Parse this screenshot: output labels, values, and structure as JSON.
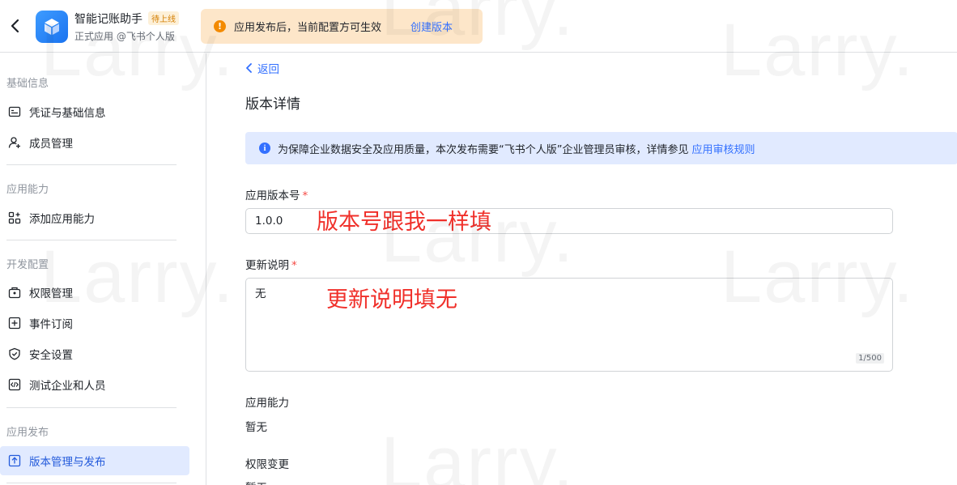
{
  "header": {
    "app_name": "智能记账助手",
    "app_badge": "待上线",
    "app_type": "正式应用 @飞书个人版",
    "notice_text": "应用发布后，当前配置方可生效",
    "notice_link": "创建版本"
  },
  "sidebar": {
    "sections": [
      {
        "title": "基础信息",
        "items": [
          "凭证与基础信息",
          "成员管理"
        ]
      },
      {
        "title": "应用能力",
        "items": [
          "添加应用能力"
        ]
      },
      {
        "title": "开发配置",
        "items": [
          "权限管理",
          "事件订阅",
          "安全设置",
          "测试企业和人员"
        ]
      },
      {
        "title": "应用发布",
        "items": [
          "版本管理与发布"
        ]
      }
    ],
    "active_item": "版本管理与发布"
  },
  "main": {
    "back_label": "返回",
    "page_title": "版本详情",
    "info_text": "为保障企业数据安全及应用质量，本次发布需要“飞书个人版”企业管理员审核，详情参见",
    "info_link": "应用审核规则",
    "version_label": "应用版本号",
    "version_value": "1.0.0",
    "version_annotation": "版本号跟我一样填",
    "notes_label": "更新说明",
    "notes_value": "无",
    "notes_counter": "1/500",
    "notes_annotation": "更新说明填无",
    "capability_label": "应用能力",
    "capability_value": "暂无",
    "permission_label": "权限变更",
    "permission_value": "暂无"
  },
  "watermark": "Larry.",
  "colors": {
    "accent": "#3370ff",
    "active_bg": "#e1eaff",
    "warning": "#f38a00",
    "required": "#f54a45",
    "annotation": "#f0302a"
  }
}
